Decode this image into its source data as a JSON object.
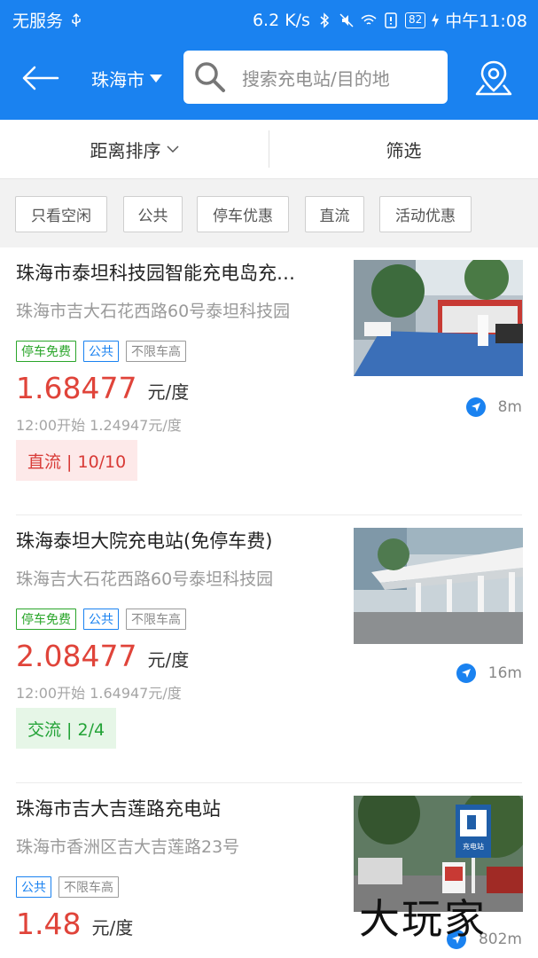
{
  "status_bar": {
    "carrier": "无服务",
    "speed": "6.2 K/s",
    "battery": "82",
    "time": "中午11:08"
  },
  "nav": {
    "city": "珠海市",
    "search_placeholder": "搜索充电站/目的地"
  },
  "sortbar": {
    "sort_label": "距离排序",
    "filter_label": "筛选"
  },
  "chips": [
    "只看空闲",
    "公共",
    "停车优惠",
    "直流",
    "活动优惠"
  ],
  "stations": [
    {
      "name": "珠海市泰坦科技园智能充电岛充…",
      "address": "珠海市吉大石花西路60号泰坦科技园",
      "tags": [
        "停车免费",
        "公共",
        "不限车高"
      ],
      "price": "1.68477",
      "unit": "元/度",
      "subprice": "12:00开始 1.24947元/度",
      "status": "直流 | 10/10",
      "distance": "8m"
    },
    {
      "name": "珠海泰坦大院充电站(免停车费)",
      "address": "珠海吉大石花西路60号泰坦科技园",
      "tags": [
        "停车免费",
        "公共",
        "不限车高"
      ],
      "price": "2.08477",
      "unit": "元/度",
      "subprice": "12:00开始 1.64947元/度",
      "status": "交流 | 2/4",
      "distance": "16m"
    },
    {
      "name": "珠海市吉大吉莲路充电站",
      "address": "珠海市香洲区吉大吉莲路23号",
      "tags": [
        "公共",
        "不限车高"
      ],
      "price": "1.48",
      "unit": "元/度",
      "distance": "802m"
    }
  ],
  "photo_sign_text": "充电站",
  "watermark": "大玩家",
  "colors": {
    "brand_blue": "#1a82f0",
    "price_red": "#e0443a",
    "dc_bg": "#fde9e9",
    "ac_bg": "#e6f6e7"
  }
}
